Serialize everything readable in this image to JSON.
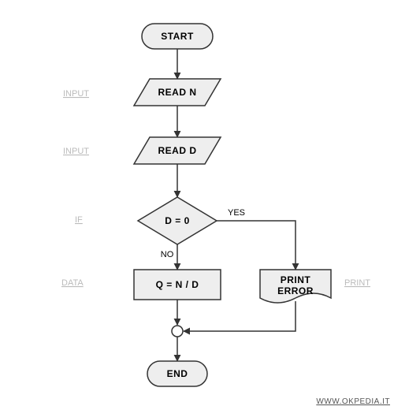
{
  "nodes": {
    "start": "START",
    "read_n": "READ N",
    "read_d": "READ D",
    "decision": "D = 0",
    "compute": "Q = N / D",
    "print_error_line1": "PRINT",
    "print_error_line2": "ERROR",
    "end": "END"
  },
  "edges": {
    "yes": "YES",
    "no": "NO"
  },
  "labels": {
    "input1": "INPUT",
    "input2": "INPUT",
    "if": "IF",
    "data": "DATA",
    "print": "PRINT"
  },
  "footer": "WWW.OKPEDIA.IT"
}
